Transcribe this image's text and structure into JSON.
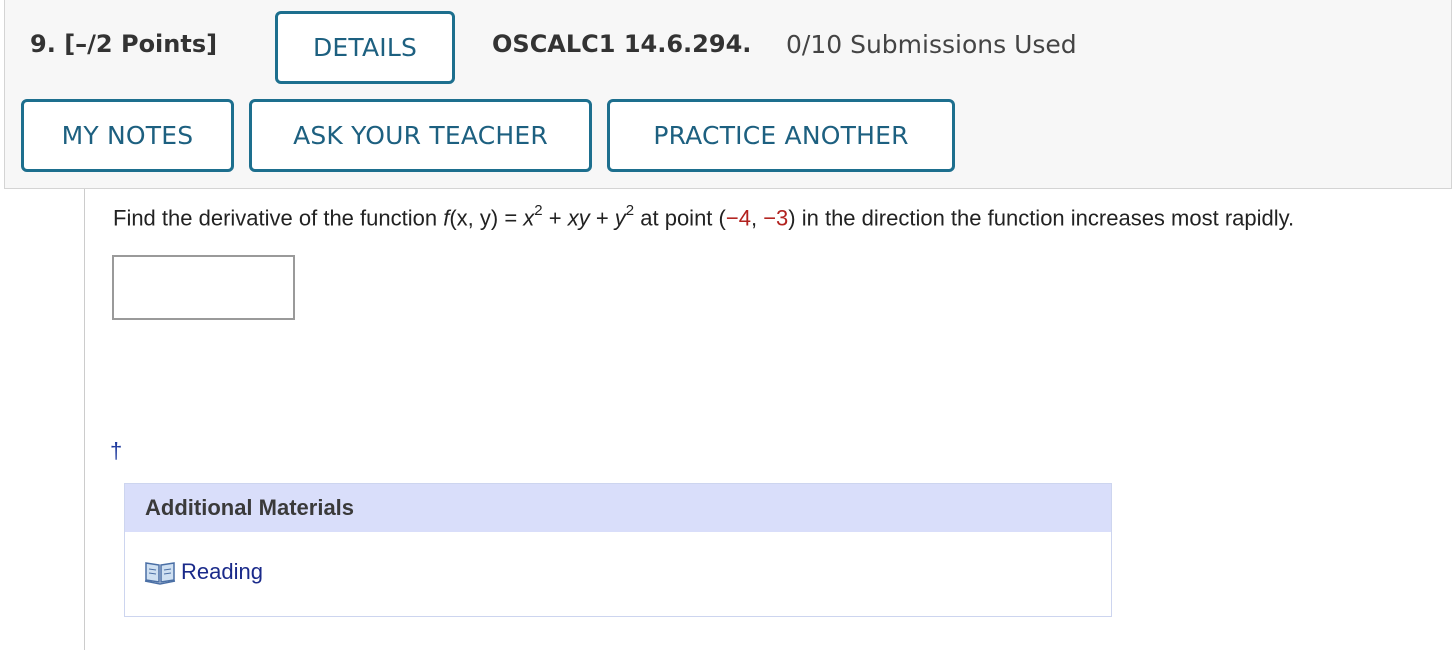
{
  "header": {
    "question_number": "9.",
    "points": "[–/2 Points]",
    "details_label": "DETAILS",
    "assignment_code": "OSCALC1 14.6.294.",
    "submissions_used": "0/10 Submissions Used",
    "my_notes_label": "MY NOTES",
    "ask_teacher_label": "ASK YOUR TEACHER",
    "practice_another_label": "PRACTICE ANOTHER"
  },
  "question": {
    "prefix": "Find the derivative of the function ",
    "func_name": "f",
    "func_args": "(x, y)",
    "equals": " = ",
    "term1_base": "x",
    "term1_exp": "2",
    "plus1": " + ",
    "term2": "xy",
    "plus2": " + ",
    "term3_base": "y",
    "term3_exp": "2",
    "point_prefix": " at point (",
    "point_x": "−4",
    "point_sep": ", ",
    "point_y": "−3",
    "suffix": ") in the direction the function increases most rapidly."
  },
  "answer": {
    "value": "",
    "placeholder": ""
  },
  "footnote_marker": "†",
  "materials": {
    "header": "Additional Materials",
    "reading_label": "Reading",
    "reading_icon": "book-icon"
  },
  "colors": {
    "button_border": "#1d6f8e",
    "button_text": "#1d6080",
    "highlight_value": "#b2211e",
    "materials_header_bg": "#d9defa",
    "link": "#1a2a8a"
  }
}
